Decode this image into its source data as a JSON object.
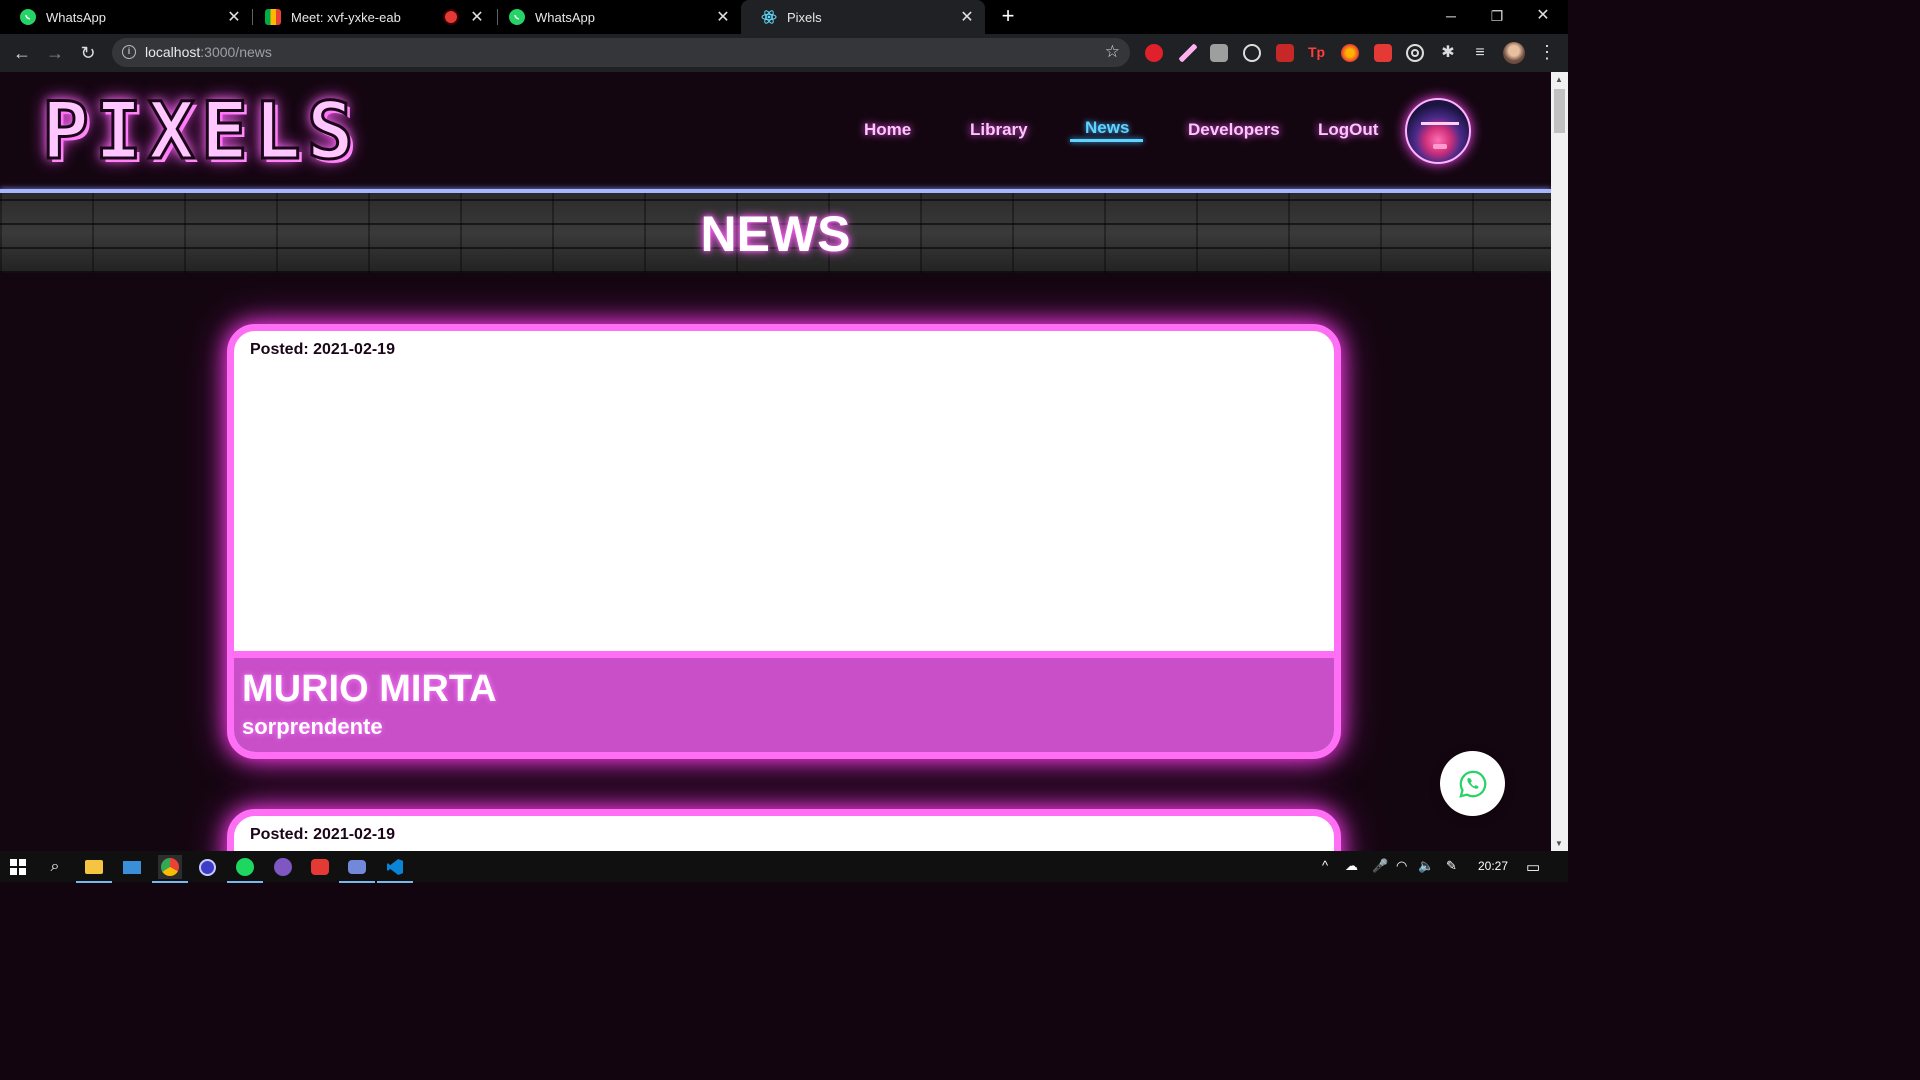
{
  "browser": {
    "tabs": [
      {
        "title": "WhatsApp",
        "icon": "whatsapp-icon"
      },
      {
        "title": "Meet: xvf-yxke-eab",
        "icon": "google-meet-icon"
      },
      {
        "title": "WhatsApp",
        "icon": "whatsapp-icon"
      },
      {
        "title": "Pixels",
        "icon": "react-icon"
      }
    ],
    "url_host": "localhost",
    "url_path": ":3000/news"
  },
  "site": {
    "logo": "PIXELS",
    "nav": {
      "home": "Home",
      "library": "Library",
      "news": "News",
      "developers": "Developers",
      "logout": "LogOut"
    },
    "active_nav": "News",
    "banner_title": "NEWS"
  },
  "news": [
    {
      "posted": "Posted: 2021-02-19",
      "title": "MURIO MIRTA",
      "subtitle": "sorprendente"
    },
    {
      "posted": "Posted: 2021-02-19"
    }
  ],
  "taskbar": {
    "clock": "20:27"
  },
  "colors": {
    "neon_pink": "#ff6ff6",
    "active_nav": "#5fd4ff",
    "card_footer": "#c84fc8",
    "background": "#140611"
  }
}
